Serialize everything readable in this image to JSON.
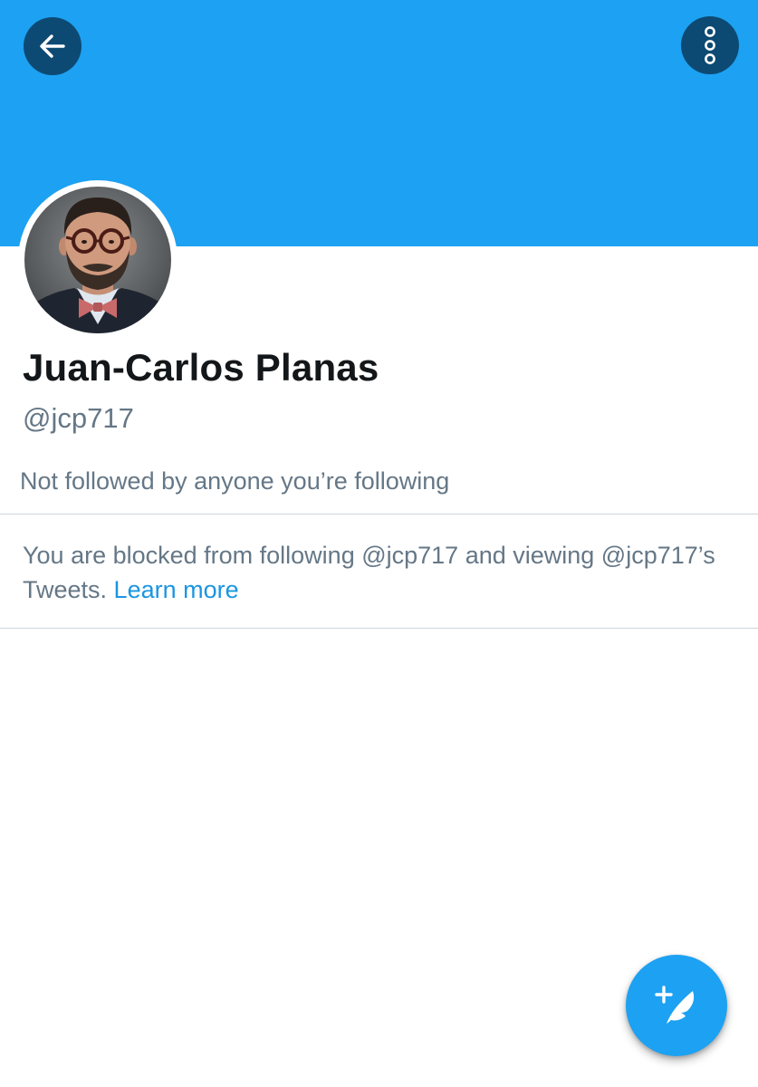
{
  "header": {
    "banner_color": "#1da1f2",
    "button_color": "#0d4a73",
    "back_icon": "arrow-left-icon",
    "more_icon": "more-vertical-icon"
  },
  "profile": {
    "avatar": "profile-photo",
    "display_name": "Juan-Carlos Planas",
    "handle": "@jcp717",
    "followers_note": "Not followed by anyone you’re following"
  },
  "blocked_notice": {
    "text": "You are blocked from following @jcp717 and viewing @jcp717’s Tweets. ",
    "link_label": "Learn more",
    "link_color": "#1b95e0"
  },
  "compose": {
    "icon": "compose-tweet-icon",
    "color": "#1da1f2"
  }
}
